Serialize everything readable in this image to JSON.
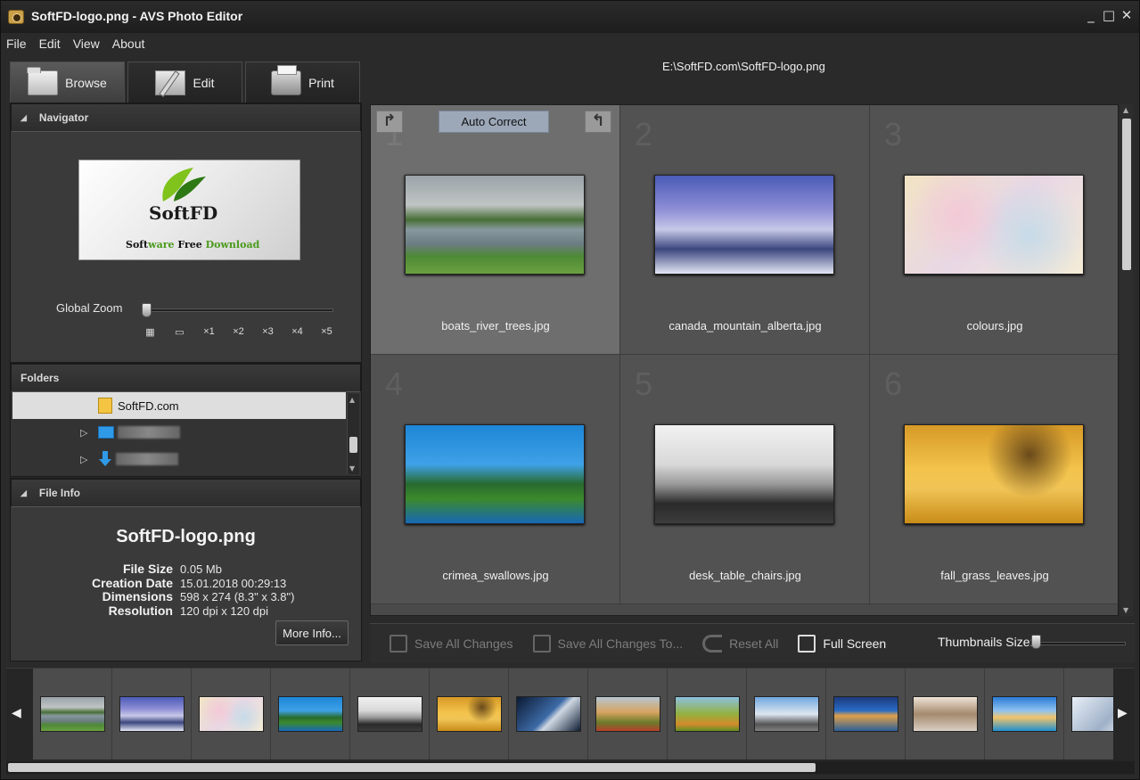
{
  "window": {
    "title": "SoftFD-logo.png  -  AVS Photo Editor",
    "controls": [
      "_",
      "□",
      "✕"
    ]
  },
  "menu": [
    "File",
    "Edit",
    "View",
    "About"
  ],
  "tabs": [
    {
      "label": "Browse",
      "icon": "browse-icon",
      "active": true
    },
    {
      "label": "Edit",
      "icon": "edit-icon",
      "active": false
    },
    {
      "label": "Print",
      "icon": "print-icon",
      "active": false
    }
  ],
  "current_path": "E:\\SoftFD.com\\SoftFD-logo.png",
  "navigator": {
    "title": "Navigator",
    "preview": {
      "brand": "SoftFD",
      "tagline_pre": "Soft",
      "tagline_mid": "ware ",
      "tagline_free": "Free",
      "tagline_end": " Download"
    },
    "zoom_label": "Global Zoom",
    "zoom_marks": [
      "▦",
      "▭",
      "×1",
      "×2",
      "×3",
      "×4",
      "×5"
    ]
  },
  "folders": {
    "title": "Folders",
    "items": [
      {
        "label": "SoftFD.com",
        "selected": true
      }
    ]
  },
  "file_info": {
    "title": "File Info",
    "name": "SoftFD-logo.png",
    "rows": [
      {
        "k": "File Size",
        "v": "0.05 Mb"
      },
      {
        "k": "Creation Date",
        "v": "15.01.2018  00:29:13"
      },
      {
        "k": "Dimensions",
        "v": "598 x 274 (8.3\" x 3.8\")"
      },
      {
        "k": "Resolution",
        "v": "120 dpi x 120 dpi"
      }
    ],
    "more_button": "More Info..."
  },
  "thumbnails": [
    {
      "num": "1",
      "caption": "boats_river_trees.jpg",
      "selected": true
    },
    {
      "num": "2",
      "caption": "canada_mountain_alberta.jpg",
      "selected": false
    },
    {
      "num": "3",
      "caption": "colours.jpg",
      "selected": false
    },
    {
      "num": "4",
      "caption": "crimea_swallows.jpg",
      "selected": false
    },
    {
      "num": "5",
      "caption": "desk_table_chairs.jpg",
      "selected": false
    },
    {
      "num": "6",
      "caption": "fall_grass_leaves.jpg",
      "selected": false
    }
  ],
  "auto_correct": "Auto Correct",
  "toolbar": {
    "save_all": "Save All Changes",
    "save_all_to": "Save All Changes To...",
    "reset_all": "Reset All",
    "full_screen": "Full Screen",
    "thumbs_size": "Thumbnails Size:"
  },
  "filmstrip_count": 14
}
